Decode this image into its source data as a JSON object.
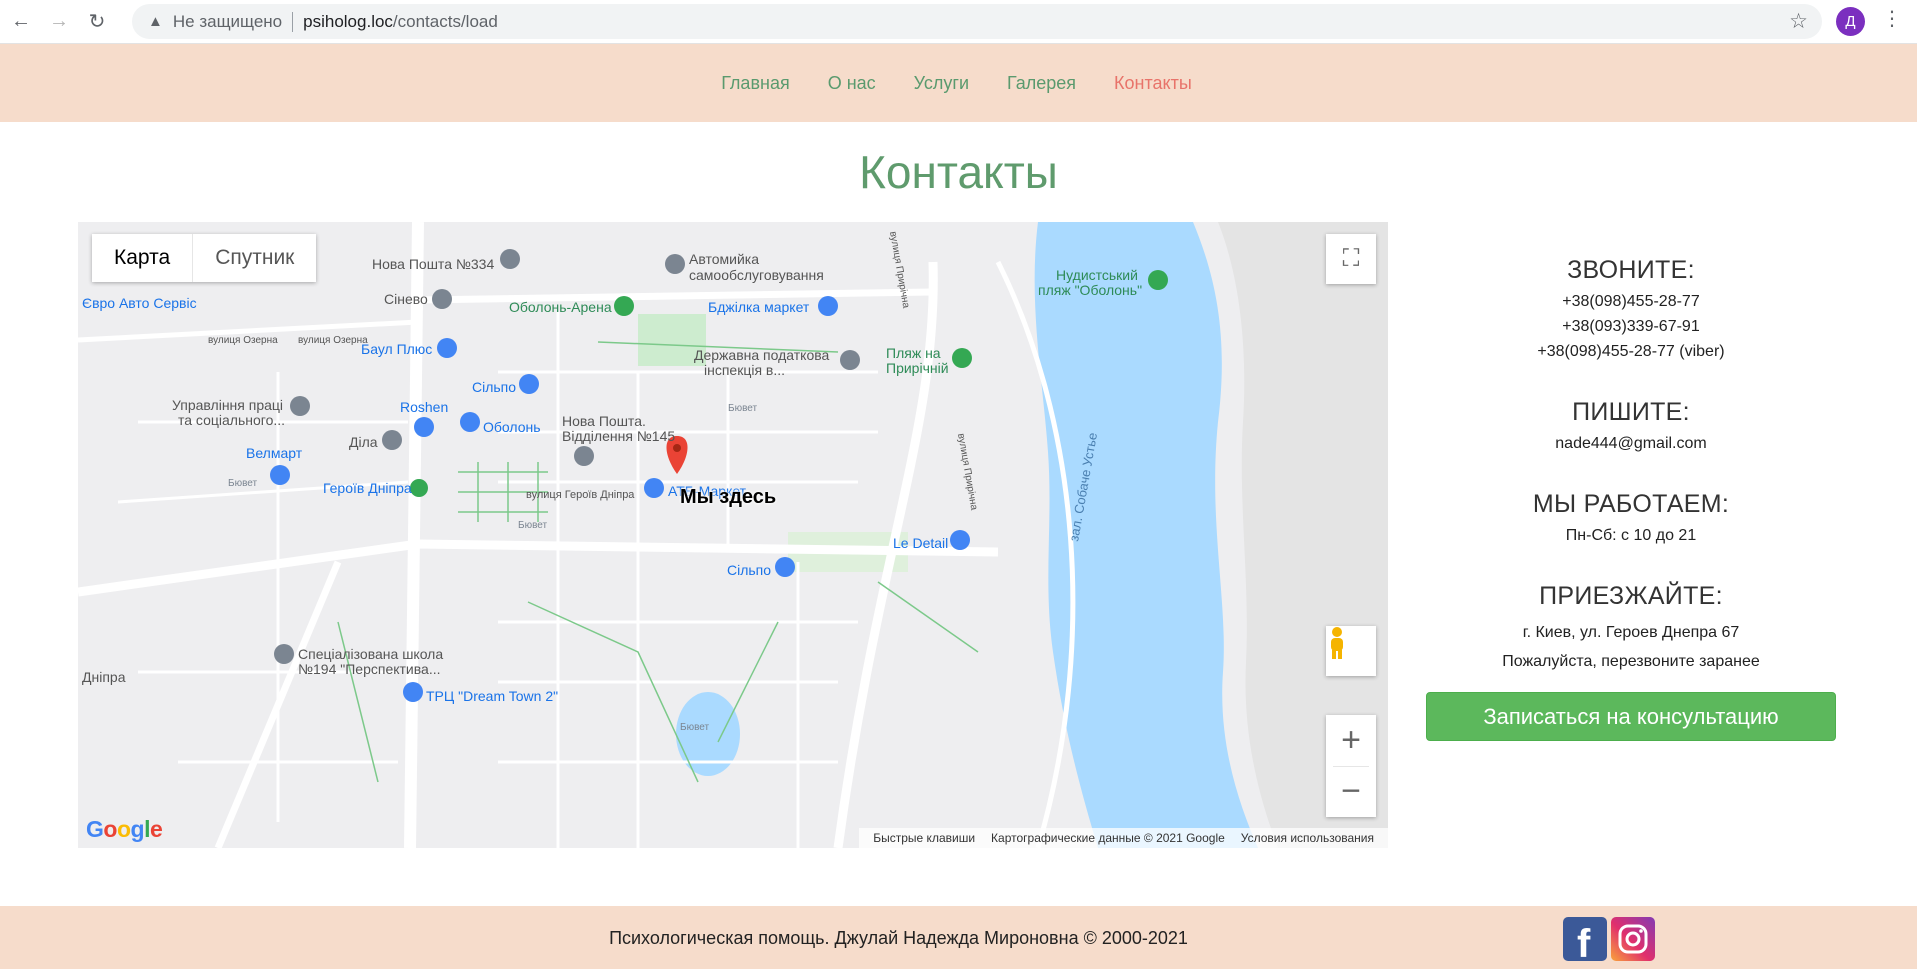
{
  "browser": {
    "security_label": "Не защищено",
    "url_host": "psiholog.loc",
    "url_path": "/contacts/load",
    "profile_initial": "Д"
  },
  "nav": {
    "items": [
      {
        "label": "Главная",
        "active": false
      },
      {
        "label": "О нас",
        "active": false
      },
      {
        "label": "Услуги",
        "active": false
      },
      {
        "label": "Галерея",
        "active": false
      },
      {
        "label": "Контакты",
        "active": true
      }
    ]
  },
  "page": {
    "title": "Контакты"
  },
  "map": {
    "type_map": "Карта",
    "type_satellite": "Спутник",
    "marker_label": "Мы здесь",
    "places": [
      "Нова Пошта №334",
      "Автомийка самообслуговування",
      "Сінево",
      "Оболонь-Арена",
      "Бджілка маркет",
      "Єврo Авто Сервіс",
      "Баул Плюс",
      "Державна податкова інспекція в...",
      "Пляж на Приручній",
      "Нудистський пляж \"Оболонь\"",
      "Сільпо",
      "Roshen",
      "Управління праці та соціального...",
      "Оболонь",
      "Нова Пошта. Відділення №145",
      "Велмарт",
      "Діла",
      "Героїв Дніпра",
      "АТБ-Маркет",
      "Le Detail",
      "Спеціалізована школа №194 \"Перспектива...",
      "ТРЦ \"Dream Town 2\"",
      "Сільпо",
      "вулиця Озерна",
      "вулиця Героїв Дніпра",
      "Бювет",
      "зал. Собаче Устье",
      "вулиця Прирічна",
      "Дніпра"
    ],
    "footer_shortcuts": "Быстрые клавиши",
    "footer_data": "Картографические данные © 2021 Google",
    "footer_terms": "Условия использования"
  },
  "contacts": {
    "call_heading": "ЗВОНИТЕ:",
    "phones": [
      "+38(098)455-28-77",
      "+38(093)339-67-91",
      "+38(098)455-28-77 (viber)"
    ],
    "write_heading": "ПИШИТЕ:",
    "email": "nade444@gmail.com",
    "hours_heading": "МЫ РАБОТАЕМ:",
    "hours": "Пн-Сб: с 10 до 21",
    "visit_heading": "ПРИЕЗЖАЙТЕ:",
    "address": "г. Киев, ул. Героев Днепра 67",
    "note": "Пожалуйста, перезвоните заранее",
    "cta_label": "Записаться на консультацию"
  },
  "footer": {
    "copyright": "Психологическая помощь. Джулай Надежда Мироновна © 2000-2021",
    "social": [
      "facebook-icon",
      "instagram-icon"
    ]
  },
  "colors": {
    "header_bg": "#f6dccb",
    "nav_link": "#5a9a6e",
    "nav_active": "#e8736a",
    "title": "#5f9b6d",
    "cta": "#5cb85c",
    "water": "#aadaff"
  }
}
